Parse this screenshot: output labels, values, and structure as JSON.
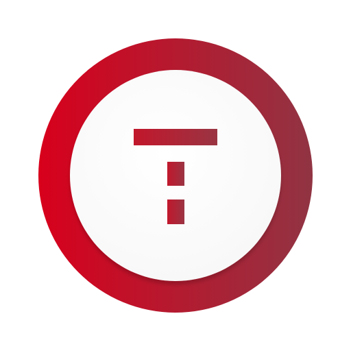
{
  "app_icon": {
    "name": "T logo app icon",
    "icon": "t-letter-icon",
    "colors": {
      "ring_start": "#d8001c",
      "ring_end": "#913443",
      "inner_disc": "#f7f7f7",
      "glyph_start": "#c2172c",
      "glyph_end": "#9a3442",
      "background": "#ffffff"
    }
  }
}
